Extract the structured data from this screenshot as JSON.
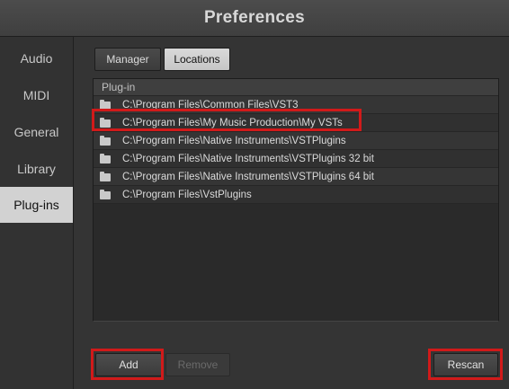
{
  "window": {
    "title": "Preferences"
  },
  "sidebar": {
    "items": [
      {
        "label": "Audio"
      },
      {
        "label": "MIDI"
      },
      {
        "label": "General"
      },
      {
        "label": "Library"
      },
      {
        "label": "Plug-ins",
        "active": true
      }
    ]
  },
  "tabs": [
    {
      "label": "Manager"
    },
    {
      "label": "Locations",
      "active": true
    }
  ],
  "list": {
    "header": "Plug-in",
    "rows": [
      "C:\\Program Files\\Common Files\\VST3",
      "C:\\Program Files\\My Music Production\\My VSTs",
      "C:\\Program Files\\Native Instruments\\VSTPlugins",
      "C:\\Program Files\\Native Instruments\\VSTPlugins 32 bit",
      "C:\\Program Files\\Native Instruments\\VSTPlugins 64 bit",
      "C:\\Program Files\\VstPlugins"
    ],
    "selected_index": 1,
    "row_icon": "folder-icon"
  },
  "buttons": {
    "add": "Add",
    "remove": "Remove",
    "rescan": "Rescan"
  },
  "colors": {
    "highlight": "#d11a1a",
    "active_sidebar": "#d2d2d2"
  }
}
